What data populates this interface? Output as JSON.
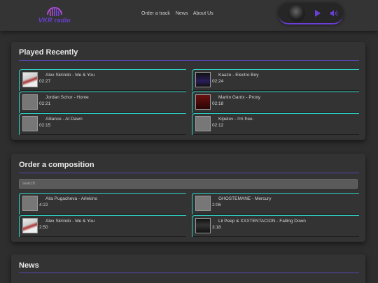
{
  "logo": {
    "text": "VKR radio"
  },
  "nav": {
    "items": [
      "Order a track",
      "News",
      "About Us"
    ]
  },
  "played_recently": {
    "title": "Played Recently",
    "tracks": [
      {
        "title": "Alex Skrindo - Me & You",
        "time": "02:27"
      },
      {
        "title": "Kaaze - Electro Boy",
        "time": "02:24"
      },
      {
        "title": "Jordan Schor - Home",
        "time": "02:21"
      },
      {
        "title": "Martin Garrix - Proxy",
        "time": "02:18"
      },
      {
        "title": "Alliance - At Dawn",
        "time": "02:15"
      },
      {
        "title": "Kipelov - I'm free.",
        "time": "02:12"
      }
    ]
  },
  "order": {
    "title": "Order a composition",
    "search_placeholder": "search",
    "tracks": [
      {
        "title": "Alla Pugacheva - Arlekino",
        "time": "4:22"
      },
      {
        "title": "GHOSTEMANE - Mercury",
        "time": "2:06"
      },
      {
        "title": "Alex Skrindo - Me & You",
        "time": "2:50"
      },
      {
        "title": "Lil Peep & XXXTENTACION - Falling Down",
        "time": "3:18"
      }
    ]
  },
  "news": {
    "title": "News"
  },
  "colors": {
    "accent": "#6a3fd6",
    "border": "#2dd3c6",
    "background": "#2e2e2e"
  }
}
